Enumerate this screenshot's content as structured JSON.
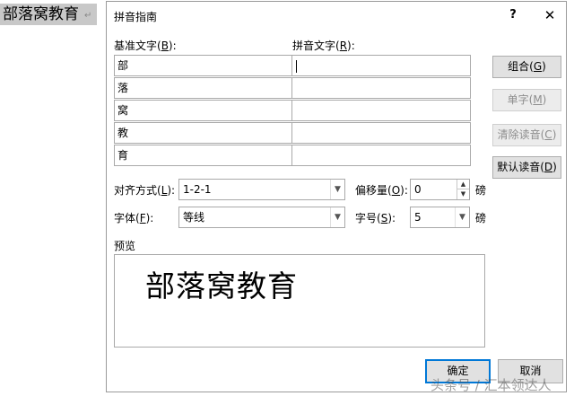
{
  "document": {
    "text": "部落窝教育",
    "paragraph_mark": "↵"
  },
  "dialog": {
    "title": "拼音指南",
    "help_label": "?",
    "close_label": "✕",
    "base_text_label": "基准文字(",
    "base_text_key": "B",
    "base_text_suffix": "):",
    "pinyin_text_label": "拼音文字(",
    "pinyin_text_key": "R",
    "pinyin_text_suffix": "):",
    "rows": [
      {
        "base": "部",
        "pinyin": ""
      },
      {
        "base": "落",
        "pinyin": ""
      },
      {
        "base": "窝",
        "pinyin": ""
      },
      {
        "base": "教",
        "pinyin": ""
      },
      {
        "base": "育",
        "pinyin": ""
      }
    ],
    "buttons": {
      "group": {
        "text": "组合(",
        "key": "G",
        "end": ")"
      },
      "single": {
        "text": "单字(",
        "key": "M",
        "end": ")"
      },
      "clear": {
        "text": "清除读音(",
        "key": "C",
        "end": ")"
      },
      "default": {
        "text": "默认读音(",
        "key": "D",
        "end": ")"
      }
    },
    "alignment": {
      "label": "对齐方式(",
      "key": "L",
      "suffix": "):",
      "value": "1-2-1"
    },
    "offset": {
      "label": "偏移量(",
      "key": "O",
      "suffix": "):",
      "value": "0",
      "unit": "磅"
    },
    "font": {
      "label": "字体(",
      "key": "F",
      "suffix": "):",
      "value": "等线"
    },
    "size": {
      "label": "字号(",
      "key": "S",
      "suffix": "):",
      "value": "5",
      "unit": "磅"
    },
    "preview": {
      "label": "预览",
      "text": "部落窝教育"
    },
    "ok_label": "确定",
    "cancel_label": "取消"
  },
  "watermark": "头条号 / 汇本领达人"
}
